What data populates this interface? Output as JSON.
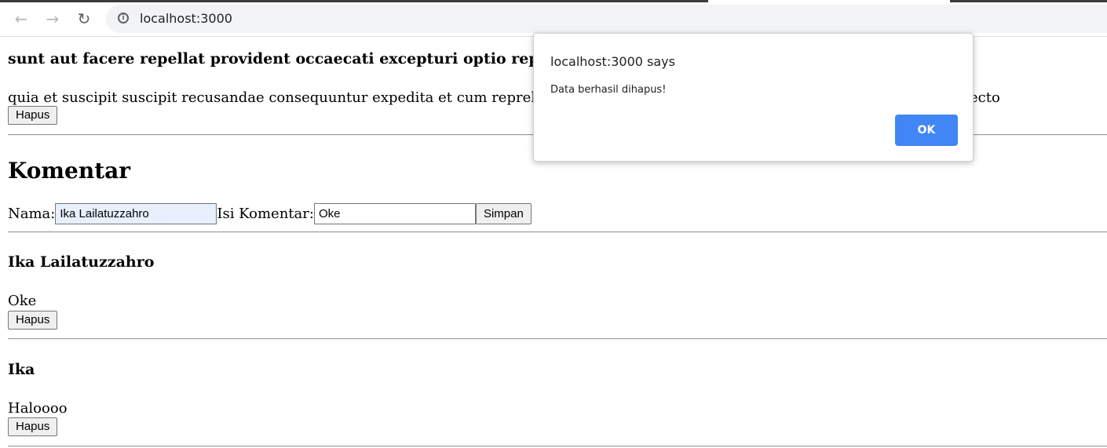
{
  "browser": {
    "url": "localhost:3000",
    "icons": {
      "back": "back-arrow-icon",
      "forward": "forward-arrow-icon",
      "reload": "reload-icon",
      "info": "info-icon"
    }
  },
  "post": {
    "title": "sunt aut facere repellat provident occaecati excepturi optio reprehe",
    "body": "quia et suscipit suscipit recusandae consequuntur expedita et cum reprehenderit mol",
    "body_tail": "itecto",
    "delete_label": "Hapus"
  },
  "komentar": {
    "heading": "Komentar",
    "form": {
      "name_label": "Nama:",
      "name_value": "Ika Lailatuzzahro",
      "comment_label": "Isi Komentar:",
      "comment_value": "Oke",
      "save_label": "Simpan"
    },
    "items": [
      {
        "name": "Ika Lailatuzzahro",
        "text": "Oke",
        "delete_label": "Hapus"
      },
      {
        "name": "Ika",
        "text": "Haloooo",
        "delete_label": "Hapus"
      }
    ]
  },
  "dialog": {
    "title": "localhost:3000 says",
    "message": "Data berhasil dihapus!",
    "ok_label": "OK",
    "ok_color": "#4285f4"
  }
}
